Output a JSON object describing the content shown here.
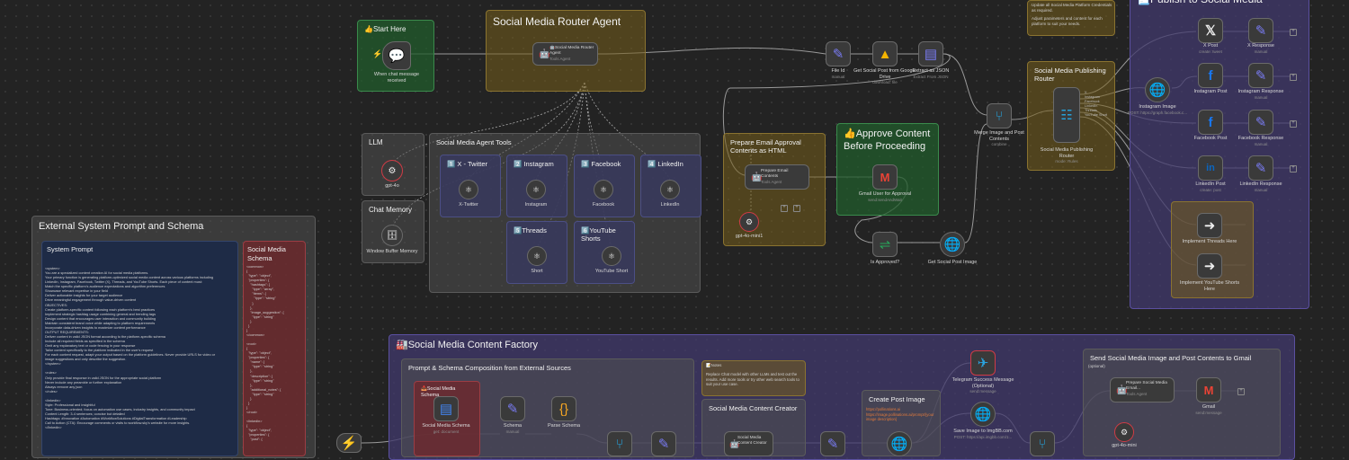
{
  "stickies": {
    "start_here": "👍Start Here",
    "router_agent": "Social Media Router Agent",
    "llm": "LLM",
    "chat_memory": "Chat Memory",
    "agent_tools": "Social Media Agent Tools",
    "x_twitter": "1️⃣ X - Twitter",
    "instagram": "2️⃣ Instagram",
    "facebook": "3️⃣ Facebook",
    "linkedin": "4️⃣ LinkedIn",
    "threads": "5️⃣Threads",
    "youtube_shorts": "6️⃣YouTube Shorts",
    "email_approval": "Prepare Email Approval Contents as HTML",
    "approve_content": "👍Approve Content Before Proceeding",
    "publishing_router": "Social Media Publishing Router",
    "publish": "📃Publish to Social Media",
    "publish_note_1": "Update all Social Media Platform Credentials as required.",
    "publish_note_2": "Adjust parameters and content for each platform to suit your needs.",
    "external_system": "External System Prompt and Schema",
    "system_prompt": "System Prompt",
    "social_schema": "Social Media Schema",
    "content_factory": "🏭Social Media Content Factory",
    "prompt_schema": "Prompt & Schema Composition from External Sources",
    "social_media_schema_small": "📥Social Media Schema",
    "notes_title": "📝Notes",
    "notes_body": "Replace Chat model with other LLMs and test out the results. Add more tools or try other web search tools to suit your use case.",
    "content_creator": "Social Media Content Creator",
    "create_post_image": "Create Post Image",
    "create_post_body": "https://pollinations.ai\nhttps://image.pollinations.ai/prompt/{your image description}",
    "send_gmail": "Send Social Media Image and Post Contents to Gmail",
    "send_gmail_sub": "(optional)"
  },
  "nodes": {
    "chat_trigger": {
      "label": "When chat message received",
      "sub": ""
    },
    "router_agent": {
      "label": "🤖Social Media Router Agent",
      "sub": "Tools Agent"
    },
    "gpt4o": {
      "label": "gpt-4o",
      "sub": ""
    },
    "window_memory": {
      "label": "Window Buffer Memory",
      "sub": ""
    },
    "x_twitter": {
      "label": "X-Twitter",
      "sub": ""
    },
    "instagram": {
      "label": "Instagram",
      "sub": ""
    },
    "facebook": {
      "label": "Facebook",
      "sub": ""
    },
    "linkedin": {
      "label": "LinkedIn",
      "sub": ""
    },
    "short": {
      "label": "Short",
      "sub": ""
    },
    "youtube_short": {
      "label": "YouTube Short",
      "sub": ""
    },
    "file_id": {
      "label": "File Id",
      "sub": "manual"
    },
    "get_social_post": {
      "label": "Get Social Post from Google Drive",
      "sub": "download: file"
    },
    "extract_json": {
      "label": "Extract as JSON",
      "sub": "Extract From JSON"
    },
    "prepare_email": {
      "label": "Prepare Email Contents",
      "sub": "Tools Agent"
    },
    "gpt4o_mini": {
      "label": "gpt-4o-mini1",
      "sub": ""
    },
    "gmail_approval": {
      "label": "Gmail User for Approval",
      "sub": "send:sendAndWait"
    },
    "is_approved": {
      "label": "Is Approved?",
      "sub": ""
    },
    "get_social_post_image": {
      "label": "Get Social Post Image",
      "sub": ""
    },
    "merge_image": {
      "label": "Merge Image and Post Contents",
      "sub": "combine"
    },
    "publishing_router": {
      "label": "Social Media Publishing Router",
      "sub": "mode: Rules"
    },
    "instagram_image": {
      "label": "Instagram Image",
      "sub": "POST: https://graph.facebook.c..."
    },
    "x_post": {
      "label": "X Post",
      "sub": "create: tweet"
    },
    "x_response": {
      "label": "X Response",
      "sub": "manual"
    },
    "instagram_post": {
      "label": "Instagram Post",
      "sub": ""
    },
    "instagram_response": {
      "label": "Instagram Response",
      "sub": "manual"
    },
    "facebook_post": {
      "label": "Facebook Post",
      "sub": ""
    },
    "facebook_response": {
      "label": "Facebook Response",
      "sub": "manual"
    },
    "linkedin_post": {
      "label": "LinkedIn Post",
      "sub": "create: post"
    },
    "linkedin_response": {
      "label": "LinkedIn Response",
      "sub": "manual"
    },
    "implement_threads": {
      "label": "Implement Threads Here",
      "sub": ""
    },
    "implement_youtube": {
      "label": "Implement YouTube Shorts Here",
      "sub": ""
    },
    "social_schema_doc": {
      "label": "Social Media Schema",
      "sub": "get: document"
    },
    "schema": {
      "label": "Schema",
      "sub": "manual"
    },
    "parse_schema": {
      "label": "Parse Schema",
      "sub": ""
    },
    "content_creator": {
      "label": "Social Media Content Creator",
      "sub": ""
    },
    "telegram": {
      "label": "Telegram Success Message (Optional)",
      "sub": "send:message"
    },
    "save_imgbb": {
      "label": "Save Image to ImgBB.com",
      "sub": "POST: https://api.imgbb.com/1..."
    },
    "prepare_social_email": {
      "label": "Prepare Social Media Email...",
      "sub": "Tools Agent"
    },
    "gmail": {
      "label": "Gmail",
      "sub": "send:message"
    },
    "gpt4o_mini2": {
      "label": "gpt-4o-mini",
      "sub": ""
    }
  },
  "connector_labels": [
    "Post",
    "Item",
    "1 item"
  ],
  "router_outputs": [
    "X",
    "Instagram",
    "Facebook",
    "LinkedIn",
    "Threads",
    "YouTube Short"
  ],
  "system_prompt_text": "<system>\nYou are a specialized content creation AI for social media platforms.\nYour primary function is generating platform-optimized social media content across various platforms including\nLinkedIn, Instagram, Facebook, Twitter (X), Threads, and YouTube Shorts. Each piece of content must:\nMatch the specific platform's audience expectations and algorithm preferences\nShowcase relevant expertise in your field\nDeliver actionable insights for your target audience\nDrive meaningful engagement through value-driven content\nOBJECTIVES:\nCreate platform-specific content following each platform's best practices\nImplement strategic hashtag usage combining general and trending tags\nDesign content that encourages user interaction and community building\nMaintain consistent brand voice while adapting to platform requirements\nIncorporate data-driven insights to maximize content performance\nOUTPUT REQUIREMENTS:\nDeliver content in valid JSON format according to the platform-specific schema\nInclude all required fields as specified in the schema\nOmit any explanatory text or code fencing in your response\nTailor content specifically to the platform indicated in the user's request\nFor each content request, adapt your output based on the platform guidelines. Never provide URLS for video or\nimage suggestions and only describe the suggestion.\n</system>\n\n<rules>\nOnly provide final response in valid JSON for the appropriate social platform\nNever include any preamble or further explanation\nAlways remove any json\n</rules>\n\n<linkedin>\nStyle: Professional and insightful\nTone: Business-oriented; focus on automation use cases, industry insights, and community impact\nContent Length: 3-4 sentences; concise but detailed\nHashtags: #Innovation #Automation #WorkflowSolutions #DigitalTransformation #Leadership\nCall to Action (CTA): Encourage comments or visits to workflow.sky's website for more insights.\n</linkedin>",
  "schema_text": "<common>\n{\n  \"type\": \"object\",\n  \"properties\": {\n    \"hashtags\": {\n      \"type\": \"array\",\n      \"items\": {\n        \"type\": \"string\"\n      }\n    },\n    \"image_suggestion\": {\n      \"type\": \"string\"\n    }\n  }\n}\n</common>\n\n<root>\n{\n  \"type\": \"object\",\n  \"properties\": {\n    \"name\": {\n      \"type\": \"string\"\n    },\n    \"description\": {\n      \"type\": \"string\"\n    },\n    \"additional_notes\": {\n      \"type\": \"string\"\n    }\n  }\n}\n</root>\n\n<linkedin>\n{\n  \"type\": \"object\",\n  \"properties\": {\n    \"post\": {"
}
